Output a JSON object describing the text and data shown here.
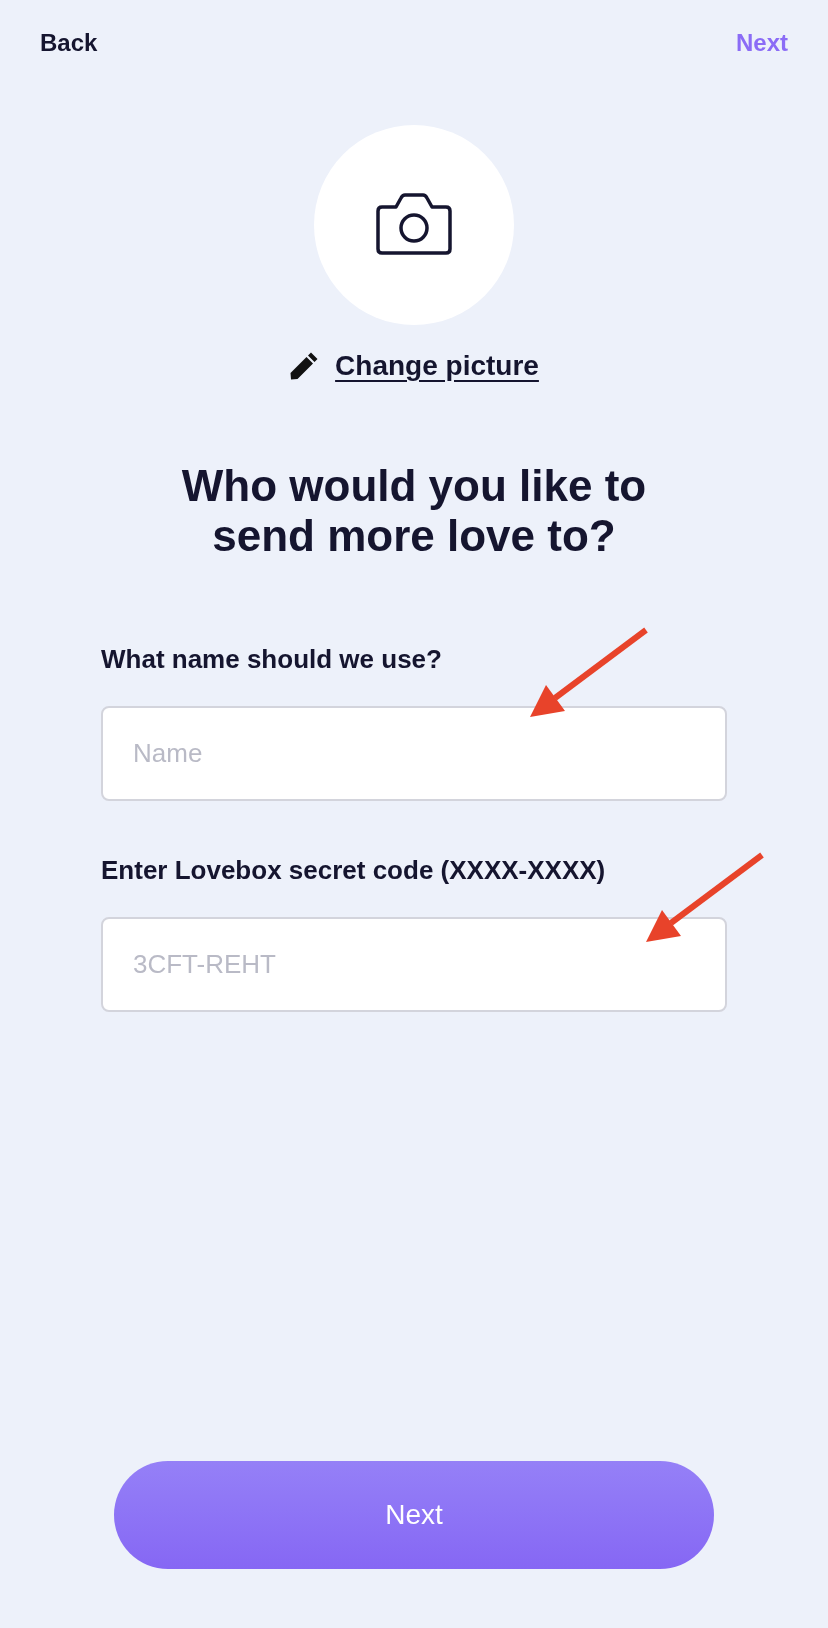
{
  "top_bar": {
    "back": "Back",
    "next": "Next"
  },
  "picture": {
    "change_link": "Change picture"
  },
  "heading": "Who would you like to send more love to?",
  "fields": [
    {
      "label": "What name should we use?",
      "placeholder": "Name"
    },
    {
      "label": "Enter Lovebox secret code (XXXX-XXXX)",
      "placeholder": "3CFT-REHT"
    }
  ],
  "primary_button": "Next"
}
